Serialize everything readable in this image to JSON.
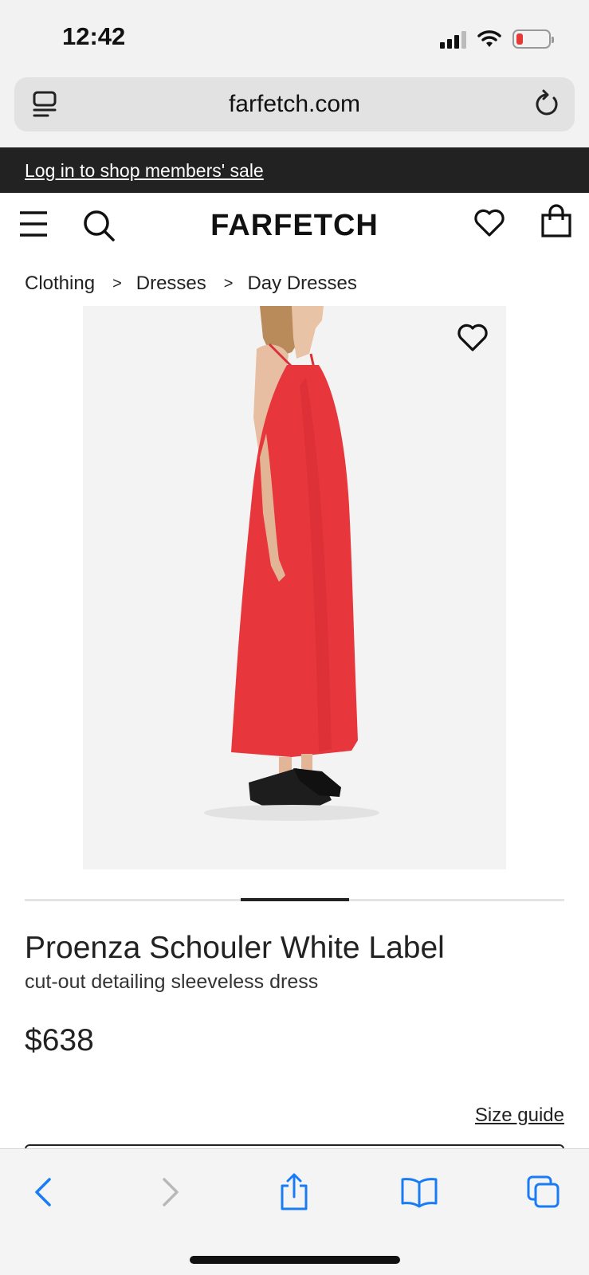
{
  "status_bar": {
    "time": "12:42"
  },
  "browser": {
    "url": "farfetch.com"
  },
  "promo": {
    "link_text": "Log in to shop members' sale"
  },
  "header": {
    "logo": "FARFETCH"
  },
  "breadcrumb": {
    "items": [
      "Clothing",
      "Dresses",
      "Day Dresses"
    ],
    "separator": ">"
  },
  "product": {
    "brand": "Proenza Schouler White Label",
    "description": "cut-out detailing sleeveless dress",
    "price": "$638",
    "size_guide_label": "Size guide",
    "image_dress_color": "#e8373c"
  },
  "carousel": {
    "position": 0.5
  },
  "colors": {
    "promo_background": "#222222",
    "safari_blue": "#1a7cf5",
    "text_primary": "#222222"
  },
  "icons": {
    "tabs_overview": "tabs-overview-icon",
    "reload": "reload-icon",
    "menu": "hamburger-menu-icon",
    "search": "search-icon",
    "wishlist": "heart-icon",
    "bag": "shopping-bag-icon",
    "back": "chevron-left-icon",
    "forward": "chevron-right-icon",
    "share": "share-icon",
    "bookmarks": "book-icon",
    "tabs": "tabs-icon"
  }
}
